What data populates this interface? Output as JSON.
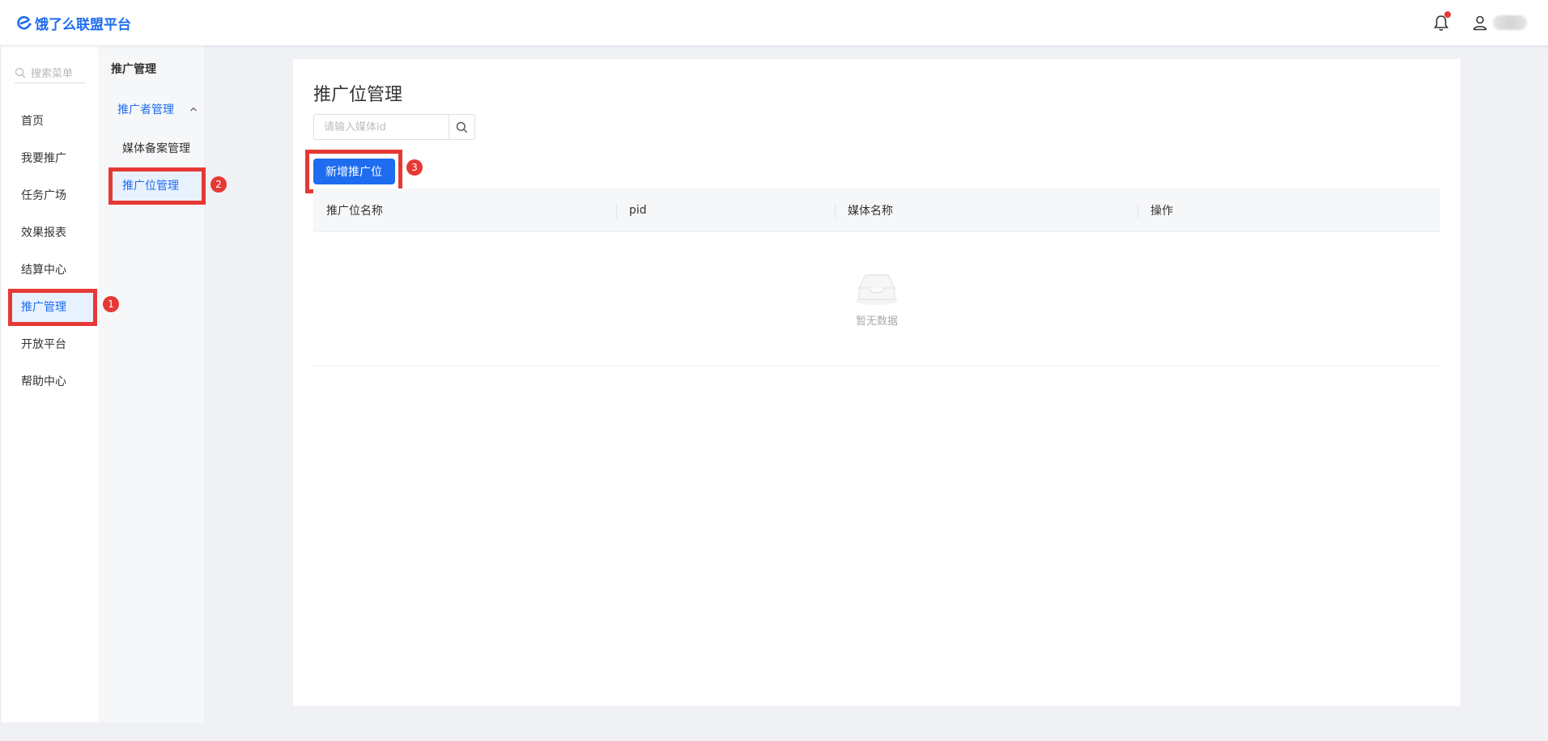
{
  "brand": {
    "name": "饿了么联盟平台",
    "color": "#1e6cf0"
  },
  "header": {
    "notification_dot": true
  },
  "sidebar": {
    "search_placeholder": "搜索菜单",
    "items": [
      {
        "label": "首页"
      },
      {
        "label": "我要推广"
      },
      {
        "label": "任务广场"
      },
      {
        "label": "效果报表"
      },
      {
        "label": "结算中心"
      },
      {
        "label": "推广管理",
        "active": true
      },
      {
        "label": "开放平台"
      },
      {
        "label": "帮助中心"
      }
    ]
  },
  "subbar": {
    "title": "推广管理",
    "group": "推广者管理",
    "items": [
      {
        "label": "媒体备案管理"
      },
      {
        "label": "推广位管理",
        "active": true
      }
    ]
  },
  "main": {
    "title": "推广位管理",
    "search_placeholder": "请输入媒体id",
    "add_button": "新增推广位",
    "table": {
      "columns": [
        "推广位名称",
        "pid",
        "媒体名称",
        "操作"
      ],
      "empty_text": "暂无数据"
    }
  },
  "badges": [
    "1",
    "2",
    "3"
  ],
  "colors": {
    "accent": "#1e6cf0",
    "highlight": "#e53935"
  }
}
